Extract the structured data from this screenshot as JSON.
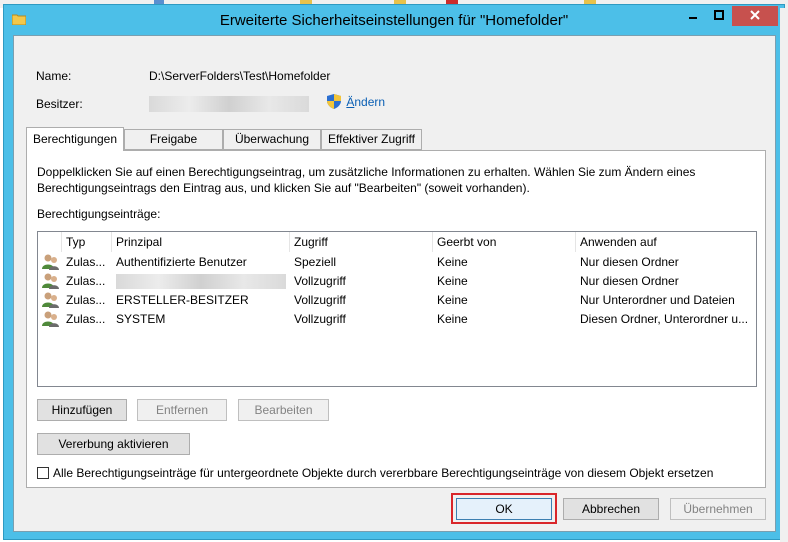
{
  "window": {
    "title": "Erweiterte Sicherheitseinstellungen für \"Homefolder\"",
    "controls": {
      "minimize": "minimize",
      "maximize": "maximize",
      "close": "close"
    }
  },
  "info": {
    "name_label": "Name:",
    "name_value": "D:\\ServerFolders\\Test\\Homefolder",
    "owner_label": "Besitzer:",
    "owner_change_link": "Ändern",
    "owner_change_accel": "Ä",
    "owner_change_rest": "ndern"
  },
  "tabs": [
    {
      "label": "Berechtigungen",
      "active": true
    },
    {
      "label": "Freigabe",
      "active": false
    },
    {
      "label": "Überwachung",
      "active": false
    },
    {
      "label": "Effektiver Zugriff",
      "active": false
    }
  ],
  "panel": {
    "description": "Doppelklicken Sie auf einen Berechtigungseintrag, um zusätzliche Informationen zu erhalten. Wählen Sie zum Ändern eines Berechtigungseintrags den Eintrag aus, und klicken Sie auf \"Bearbeiten\" (soweit vorhanden).",
    "description_line1": "Doppelklicken Sie auf einen Berechtigungseintrag, um zusätzliche Informationen zu erhalten. Wählen Sie zum Ändern eines",
    "description_line2": "Berechtigungseintrags den Eintrag aus, und klicken Sie auf \"Bearbeiten\" (soweit vorhanden).",
    "entries_label": "Berechtigungseinträge:",
    "columns": [
      "Typ",
      "Prinzipal",
      "Zugriff",
      "Geerbt von",
      "Anwenden auf"
    ],
    "rows": [
      {
        "type": "Zulas...",
        "principal": "Authentifizierte Benutzer",
        "access": "Speziell",
        "inherited": "Keine",
        "applies": "Nur diesen Ordner"
      },
      {
        "type": "Zulas...",
        "principal": "",
        "access": "Vollzugriff",
        "inherited": "Keine",
        "applies": "Nur diesen Ordner"
      },
      {
        "type": "Zulas...",
        "principal": "ERSTELLER-BESITZER",
        "access": "Vollzugriff",
        "inherited": "Keine",
        "applies": "Nur Unterordner und Dateien"
      },
      {
        "type": "Zulas...",
        "principal": "SYSTEM",
        "access": "Vollzugriff",
        "inherited": "Keine",
        "applies": "Diesen Ordner, Unterordner u..."
      }
    ],
    "buttons": {
      "add": "Hinzufügen",
      "remove": "Entfernen",
      "edit": "Bearbeiten",
      "enable_inheritance": "Vererbung aktivieren"
    },
    "replace_checkbox_label": "Alle Berechtigungseinträge für untergeordnete Objekte durch vererbbare Berechtigungseinträge von diesem Objekt ersetzen",
    "replace_checkbox_checked": false
  },
  "footer": {
    "ok": "OK",
    "cancel": "Abbrechen",
    "apply": "Übernehmen"
  },
  "icons": {
    "title": "folder-icon",
    "change": "shield-icon",
    "row": "user-group-icon"
  },
  "colors": {
    "frame": "#4cbfe8",
    "close": "#c7514e",
    "highlight": "#d9262a",
    "link": "#0a5fb4"
  }
}
